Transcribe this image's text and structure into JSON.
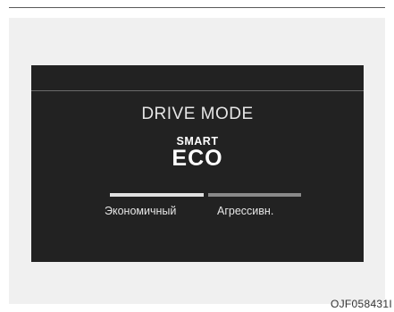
{
  "display": {
    "title": "DRIVE MODE",
    "mode_sub": "SMART",
    "mode_main": "ECO",
    "left_label": "Экономичный",
    "right_label": "Агрессивн.",
    "colors": {
      "screen_background": "#222222",
      "text": "#e6e6e6",
      "bar_active": "#e0e0e0",
      "bar_inactive": "#8a8a8a"
    }
  },
  "figure_code": "OJF058431I"
}
